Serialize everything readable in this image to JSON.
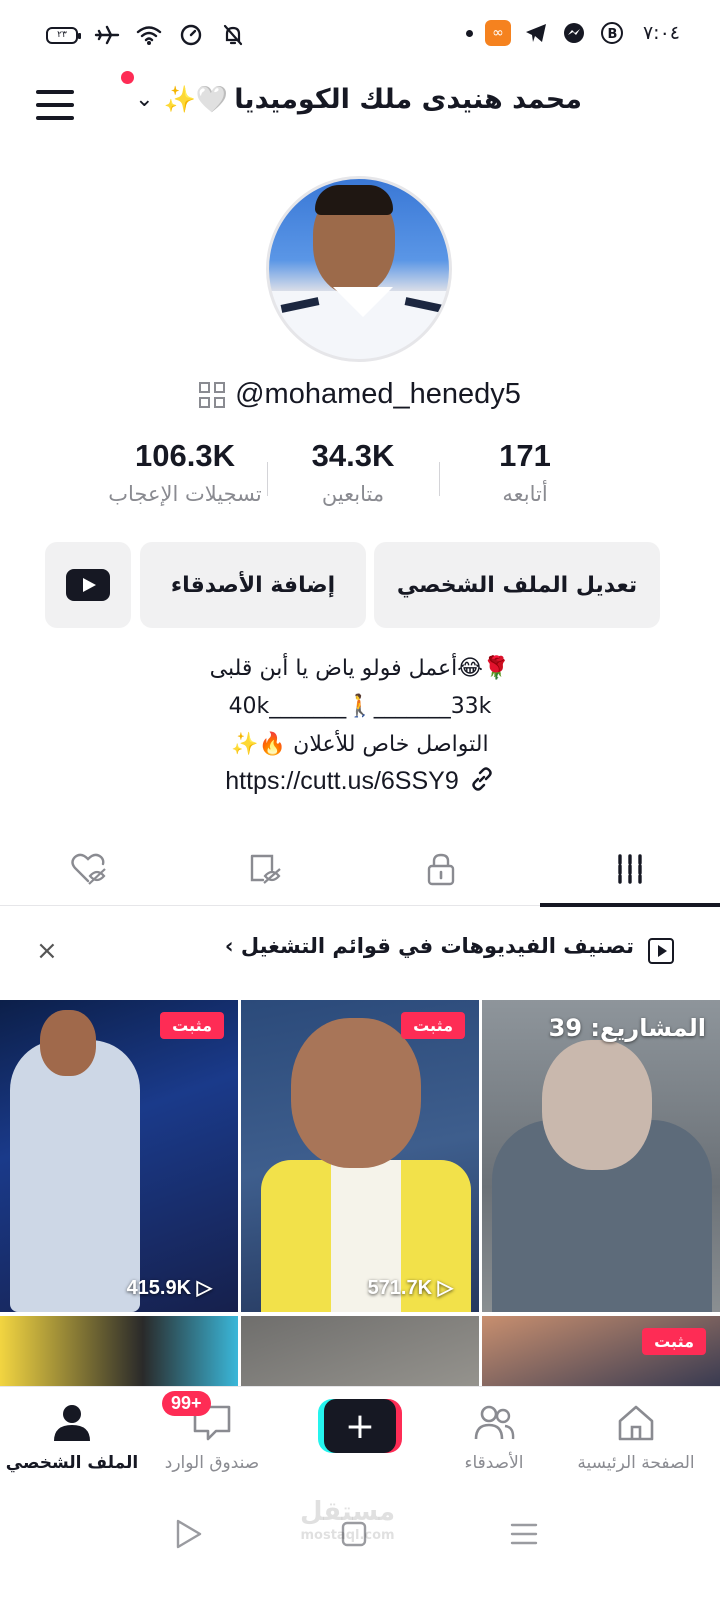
{
  "status_bar": {
    "battery": "٢٣",
    "time": "٧:٠٤"
  },
  "header": {
    "username": "محمد هنيدى ملك الكوميديا",
    "username_emojis": "✨🤍",
    "chevron": "⌄"
  },
  "profile": {
    "handle": "@mohamed_henedy5",
    "stats": [
      {
        "value": "171",
        "label": "أتابعه"
      },
      {
        "value": "34.3K",
        "label": "متابعين"
      },
      {
        "value": "106.3K",
        "label": "تسجيلات الإعجاب"
      }
    ],
    "buttons": {
      "edit_profile": "تعديل الملف الشخصي",
      "add_friends": "إضافة الأصدقاء"
    },
    "bio": {
      "line1": "أعمل فولو ياض يا أبن قلبى😂🌹",
      "line2": "40k_______🚶_______33k",
      "line3": "التواصل خاص للأعلان 🔥✨"
    },
    "link": "https://cutt.us/6SSY9"
  },
  "tabs": {
    "active": "videos",
    "items": [
      "videos",
      "private",
      "reposts",
      "liked"
    ]
  },
  "playlist_banner": {
    "text": "تصنيف الفيديوهات في قوائم التشغيل",
    "arrow": "›",
    "close": "×"
  },
  "grid": {
    "tiles": [
      {
        "badge": "مثبت",
        "views": "415.9K"
      },
      {
        "badge": "مثبت",
        "views": "571.7K"
      },
      {
        "projects_label": "المشاريع: 39"
      },
      {},
      {},
      {
        "badge": "مثبت"
      }
    ]
  },
  "bottom_nav": {
    "items": [
      {
        "label": "الصفحة الرئيسية"
      },
      {
        "label": "الأصدقاء"
      },
      {
        "label": "+"
      },
      {
        "label": "صندوق الوارد",
        "badge": "99+"
      },
      {
        "label": "الملف الشخصي"
      }
    ],
    "active": "الملف الشخصي"
  },
  "watermark": {
    "main": "مستقل",
    "sub": "mostaql.com"
  },
  "colors": {
    "accent": "#fe2c55",
    "cyan": "#25f4ee",
    "text": "#161823",
    "muted": "#8a8b91"
  }
}
